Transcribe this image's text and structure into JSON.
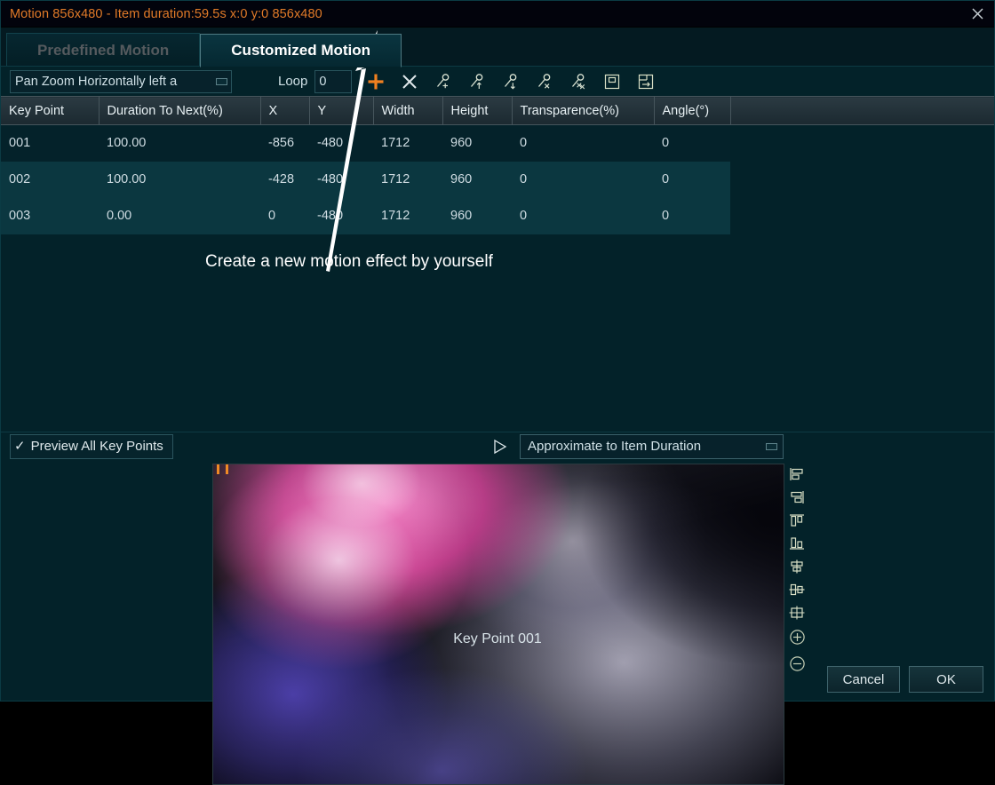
{
  "window": {
    "title": "Motion 856x480 - Item duration:59.5s x:0 y:0 856x480",
    "title_color": "#e07a28",
    "close_icon": "close-icon"
  },
  "tabs": [
    {
      "label": "Predefined Motion",
      "active": false
    },
    {
      "label": "Customized Motion",
      "active": true
    }
  ],
  "toolbar": {
    "motion_preset": "Pan Zoom Horizontally left a",
    "loop_label": "Loop",
    "loop_value": "0",
    "buttons": [
      {
        "name": "add-key-point-button",
        "icon": "plus-icon",
        "color": "#f08020"
      },
      {
        "name": "delete-key-point-button",
        "icon": "close-x-icon",
        "color": "#dfe7ea"
      },
      {
        "name": "add-key-icon-button",
        "icon": "key-plus-icon",
        "color": "#d9e2d2"
      },
      {
        "name": "move-key-up-button",
        "icon": "key-up-arrow-icon",
        "color": "#d9e2d2"
      },
      {
        "name": "move-key-down-button",
        "icon": "key-down-arrow-icon",
        "color": "#d9e2d2"
      },
      {
        "name": "remove-key-button",
        "icon": "key-x-icon",
        "color": "#d9e2d2"
      },
      {
        "name": "remove-all-keys-button",
        "icon": "key-double-x-icon",
        "color": "#d9e2d2"
      },
      {
        "name": "save-motion-button",
        "icon": "save-box-icon",
        "color": "#d9dfc6"
      },
      {
        "name": "export-motion-button",
        "icon": "export-box-icon",
        "color": "#d9dfc6"
      }
    ]
  },
  "table": {
    "columns": [
      "Key Point",
      "Duration To Next(%)",
      "X",
      "Y",
      "Width",
      "Height",
      "Transparence(%)",
      "Angle(°)"
    ],
    "rows": [
      {
        "key_point": "001",
        "duration": "100.00",
        "x": "-856",
        "y": "-480",
        "width": "1712",
        "height": "960",
        "transparence": "0",
        "angle": "0"
      },
      {
        "key_point": "002",
        "duration": "100.00",
        "x": "-428",
        "y": "-480",
        "width": "1712",
        "height": "960",
        "transparence": "0",
        "angle": "0"
      },
      {
        "key_point": "003",
        "duration": "0.00",
        "x": "0",
        "y": "-480",
        "width": "1712",
        "height": "960",
        "transparence": "0",
        "angle": "0"
      }
    ]
  },
  "annotation": {
    "text": "Create a new motion effect by yourself",
    "arrow": "arrow-pointing-to-add-button"
  },
  "preview_controls": {
    "preview_all_label": "Preview All Key Points",
    "preview_all_checked": true,
    "play_icon": "play-triangle-icon",
    "duration_mode": "Approximate to Item Duration"
  },
  "align_tools": [
    {
      "name": "align-left-icon"
    },
    {
      "name": "align-right-icon"
    },
    {
      "name": "align-top-icon"
    },
    {
      "name": "align-bottom-icon"
    },
    {
      "name": "center-horizontally-icon"
    },
    {
      "name": "center-vertically-icon"
    },
    {
      "name": "center-both-icon"
    },
    {
      "name": "zoom-in-icon"
    },
    {
      "name": "zoom-out-icon"
    }
  ],
  "stage": {
    "caption": "Key Point 001"
  },
  "footer": {
    "cancel_label": "Cancel",
    "ok_label": "OK"
  },
  "colors": {
    "window_bg": "#032229",
    "titlebar_bg": "#02030c",
    "accent_orange": "#e07a28",
    "row_alt_bg": "#0b3740",
    "header_bg": "#2b3a42"
  }
}
